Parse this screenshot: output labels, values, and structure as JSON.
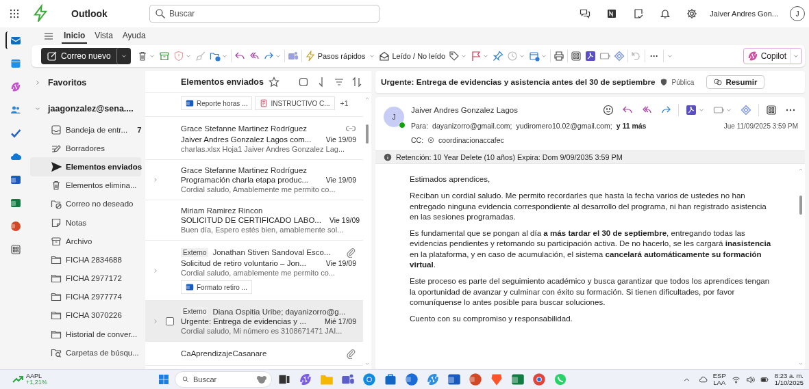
{
  "app_bar": {
    "app_name": "Outlook",
    "search": {
      "placeholder": "Buscar"
    },
    "user_name": "Jaiver Andres Gon...",
    "avatar": "J"
  },
  "ribbon": {
    "tabs": [
      {
        "label": "Inicio",
        "selected": true
      },
      {
        "label": "Vista",
        "selected": false
      },
      {
        "label": "Ayuda",
        "selected": false
      }
    ],
    "new_mail": "Correo nuevo",
    "quick_steps": "Pasos rápidos",
    "read_unread": "Leído / No leído",
    "more": "···",
    "copilot": "Copilot"
  },
  "folders": {
    "favorites": "Favoritos",
    "account": "jaagonzalez@sena....",
    "items": [
      {
        "kind": "inbox",
        "label": "Bandeja de entr...",
        "count": "7",
        "selected": false
      },
      {
        "kind": "drafts",
        "label": "Borradores",
        "selected": false
      },
      {
        "kind": "sent",
        "label": "Elementos enviados",
        "selected": true
      },
      {
        "kind": "deleted",
        "label": "Elementos elimina...",
        "selected": false
      },
      {
        "kind": "junk",
        "label": "Correo no deseado",
        "selected": false
      },
      {
        "kind": "notes",
        "label": "Notas",
        "selected": false
      },
      {
        "kind": "archive",
        "label": "Archivo",
        "selected": false
      },
      {
        "kind": "folder",
        "label": "FICHA 2834688",
        "selected": false
      },
      {
        "kind": "folder",
        "label": "FICHA 2977172",
        "selected": false
      },
      {
        "kind": "folder",
        "label": "FICHA 2977774",
        "selected": false
      },
      {
        "kind": "folder",
        "label": "FICHA 3070226",
        "selected": false
      },
      {
        "kind": "folder",
        "label": "Historial de conver...",
        "selected": false
      },
      {
        "kind": "search",
        "label": "Carpetas de búsqu...",
        "selected": false
      }
    ]
  },
  "message_list": {
    "title": "Elementos enviados",
    "top_attachments": [
      "Reporte horas ...",
      "INSTRUCTIVO C..."
    ],
    "top_more": "+1",
    "messages": [
      {
        "sender": "Grace Stefanne Martinez Rodríguez",
        "subject": "Jaiver Andres Gonzalez Lagos com...",
        "date": "Vie 19/09",
        "preview": "charlas.xlsx Hoja1 Jaiver Andres Gonzalez Lag...",
        "expandable": false,
        "shared_link": true,
        "attachment": false,
        "selected": false
      },
      {
        "sender": "Grace Stefanne Martinez Rodríguez",
        "subject": "Programación charla etapa produc...",
        "date": "Vie 19/09",
        "preview": "Cordial saludo, Amablemente me permito co...",
        "expandable": true,
        "shared_link": false,
        "attachment": false,
        "selected": false
      },
      {
        "sender": "Miriam Ramirez Rincon",
        "subject": "SOLICITUD DE CERTIFICADO LABO...",
        "date": "Vie 19/09",
        "preview": "Buen día, Espero estés bien, amablemente sol...",
        "expandable": false,
        "shared_link": false,
        "attachment": false,
        "selected": false
      },
      {
        "tag": "Externo",
        "sender": "Jonathan Stiven Sandoval Esco...",
        "subject": "Solicitud de retiro voluntario – Jon...",
        "date": "Vie 19/09",
        "preview": "Cordial saludo, amablemente me permito co...",
        "attachments": [
          "Formato retiro ..."
        ],
        "expandable": true,
        "shared_link": false,
        "attachment": true,
        "selected": false
      },
      {
        "tag": "Externo",
        "sender": "Diana Ospitia Uribe; dayanizorro@g...",
        "subject": "Urgente: Entrega de evidencias y ...",
        "date": "Mié 17/09",
        "preview": "Cordial saludo, Mi número es 3108671471 JAI...",
        "expandable": true,
        "shared_link": false,
        "attachment": false,
        "selected": true
      },
      {
        "sender": "CaAprendizajeCasanare",
        "expandable": false,
        "shared_link": false,
        "attachment": true,
        "selected": false
      }
    ]
  },
  "reading": {
    "subject": "Urgente: Entrega de evidencias y asistencia antes del 30 de septiembre",
    "sensitivity": "Pública",
    "summarize": "Resumir",
    "sender": "Jaiver Andres Gonzalez Lagos",
    "avatar": "J",
    "to_label": "Para:",
    "to": [
      "dayanizorro@gmail.com;",
      "yudiromero10.02@gmail.com;"
    ],
    "to_more": "y 11 más",
    "date": "Jue 11/09/2025 3:59 PM",
    "cc_label": "CC:",
    "cc": "coordinacionaccafec",
    "retention": "Retención: 10 Year Delete (10 años) Expira: Dom 9/09/2035 3:59 PM",
    "body": [
      "Estimados aprendices,",
      "Reciban un cordial saludo. Me permito recordarles que hasta la fecha varios de ustedes no han entregado ninguna evidencia correspondiente al desarrollo del programa, ni han registrado asistencia en las sesiones programadas.",
      "Es fundamental que se pongan al día **a más tardar el 30 de septiembre**, entregando todas las evidencias pendientes y retomando su participación activa. De no hacerlo, se les cargará **inasistencia** en la plataforma, y en caso de acumulación, el sistema **cancelará automáticamente su formación virtual**.",
      "Este proceso es parte del seguimiento académico y busca garantizar que todos los aprendices tengan la oportunidad de avanzar y culminar con éxito su formación. Si tienen dificultades, por favor comuníquense lo antes posible para buscar soluciones.",
      "Cuento con su compromiso y responsabilidad."
    ]
  },
  "taskbar": {
    "stock_symbol": "AAPL",
    "stock_change": "+1,21%",
    "search_placeholder": "Buscar",
    "language": "ESP",
    "layout": "LAA",
    "time": "8:23 a. m.",
    "date": "1/10/2025"
  }
}
